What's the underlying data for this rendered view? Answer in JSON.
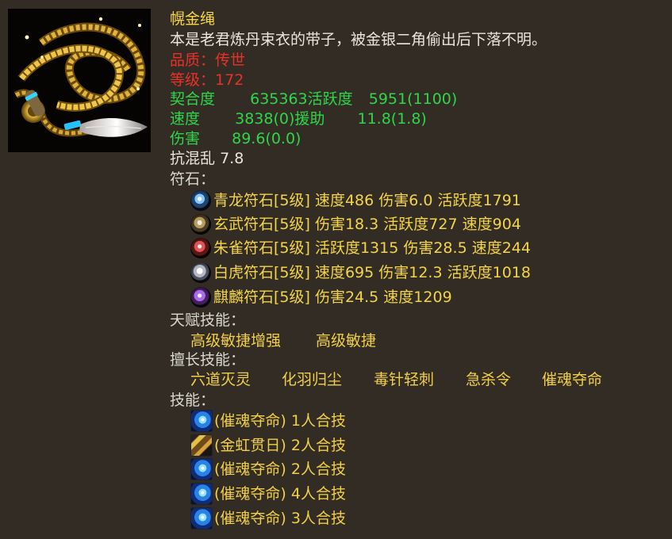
{
  "item": {
    "name": "幌金绳",
    "description": "本是老君炼丹束衣的带子，被金银二角偷出后下落不明。",
    "quality_label": "品质：",
    "quality_value": "传世",
    "level_label": "等级：",
    "level_value": "172",
    "affinity_label": "契合度",
    "affinity_value": "635363",
    "activity_label": "活跃度",
    "activity_value": "5951(1100)",
    "speed_label": "速度",
    "speed_value": "3838(0)",
    "assist_label": "援助",
    "assist_value": "11.8(1.8)",
    "damage_label": "伤害",
    "damage_value": "89.6(0.0)",
    "anti_chaos_label": "抗混乱",
    "anti_chaos_value": "7.8"
  },
  "runes": {
    "title": "符石：",
    "items": [
      {
        "icon": "azure-dragon-rune-icon",
        "text": "青龙符石[5级] 速度486 伤害6.0 活跃度1791"
      },
      {
        "icon": "black-tortoise-rune-icon",
        "text": "玄武符石[5级] 伤害18.3 活跃度727 速度904"
      },
      {
        "icon": "vermilion-bird-rune-icon",
        "text": "朱雀符石[5级] 活跃度1315 伤害28.5 速度244"
      },
      {
        "icon": "white-tiger-rune-icon",
        "text": "白虎符石[5级] 速度695 伤害12.3 活跃度1018"
      },
      {
        "icon": "qilin-rune-icon",
        "text": "麒麟符石[5级] 伤害24.5 速度1209"
      }
    ]
  },
  "talent": {
    "title": "天赋技能：",
    "items": [
      "高级敏捷增强",
      "高级敏捷"
    ]
  },
  "specialty": {
    "title": "擅长技能：",
    "items": [
      "六道灭灵",
      "化羽归尘",
      "毒针轻刺",
      "急杀令",
      "催魂夺命"
    ]
  },
  "skills": {
    "title": "技能：",
    "items": [
      {
        "icon": "blue-vortex-skill-icon",
        "text": "(催魂夺命) 1人合技"
      },
      {
        "icon": "golden-rainbow-skill-icon",
        "text": "(金虹贯日) 2人合技"
      },
      {
        "icon": "blue-vortex-skill-icon",
        "text": "(催魂夺命) 2人合技"
      },
      {
        "icon": "blue-vortex-skill-icon",
        "text": "(催魂夺命) 4人合技"
      },
      {
        "icon": "blue-vortex-skill-icon",
        "text": "(催魂夺命) 3人合技"
      }
    ]
  },
  "colors": {
    "background": "#322c24",
    "name_yellow": "#f5d64a",
    "quality_red": "#e8312a",
    "stat_green": "#2fd64a",
    "rune_gold": "#f3d44b"
  }
}
